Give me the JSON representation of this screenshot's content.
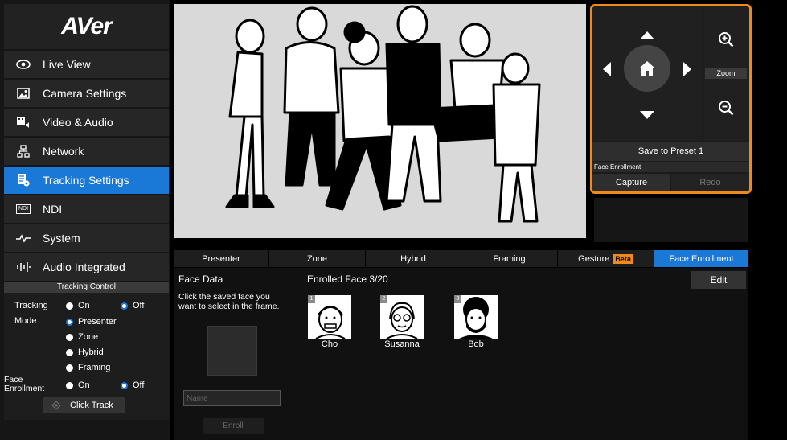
{
  "logo": "AVer",
  "nav": [
    {
      "label": "Live View",
      "icon": "eye-icon"
    },
    {
      "label": "Camera Settings",
      "icon": "image-icon"
    },
    {
      "label": "Video & Audio",
      "icon": "video-audio-icon"
    },
    {
      "label": "Network",
      "icon": "network-icon"
    },
    {
      "label": "Tracking Settings",
      "icon": "tracking-settings-icon"
    },
    {
      "label": "NDI",
      "icon": "ndi-icon"
    },
    {
      "label": "System",
      "icon": "pulse-icon"
    },
    {
      "label": "Audio Integrated",
      "icon": "audio-bars-icon"
    }
  ],
  "nav_active": "Tracking Settings",
  "tracking_control": {
    "title": "Tracking Control",
    "tracking_label": "Tracking",
    "mode_label": "Mode",
    "face_enrollment_label": "Face Enrollment",
    "on": "On",
    "off": "Off",
    "tracking_value": "Off",
    "mode_options": [
      "Presenter",
      "Zone",
      "Hybrid",
      "Framing"
    ],
    "mode_value": "Presenter",
    "face_enrollment_value": "Off",
    "click_track": "Click Track",
    "ndi_icon_text": "NDI"
  },
  "ptz": {
    "zoom_label": "Zoom",
    "save_preset": "Save to Preset 1",
    "face_enrollment": "Face Enrollment",
    "capture": "Capture",
    "redo": "Redo"
  },
  "tabs": [
    {
      "label": "Presenter"
    },
    {
      "label": "Zone"
    },
    {
      "label": "Hybrid"
    },
    {
      "label": "Framing"
    },
    {
      "label": "Gesture",
      "badge": "Beta"
    },
    {
      "label": "Face Enrollment"
    }
  ],
  "tab_active": "Face Enrollment",
  "face_data": {
    "title": "Face Data",
    "hint": "Click the saved face you want to select in the frame.",
    "name_placeholder": "Name",
    "enroll": "Enroll"
  },
  "enrolled": {
    "title": "Enrolled Face 3/20",
    "edit": "Edit",
    "faces": [
      {
        "num": "1",
        "name": "Cho"
      },
      {
        "num": "2",
        "name": "Susanna"
      },
      {
        "num": "3",
        "name": "Bob"
      }
    ]
  },
  "colors": {
    "accent": "#1a78d6",
    "highlight": "#f08a1c"
  }
}
